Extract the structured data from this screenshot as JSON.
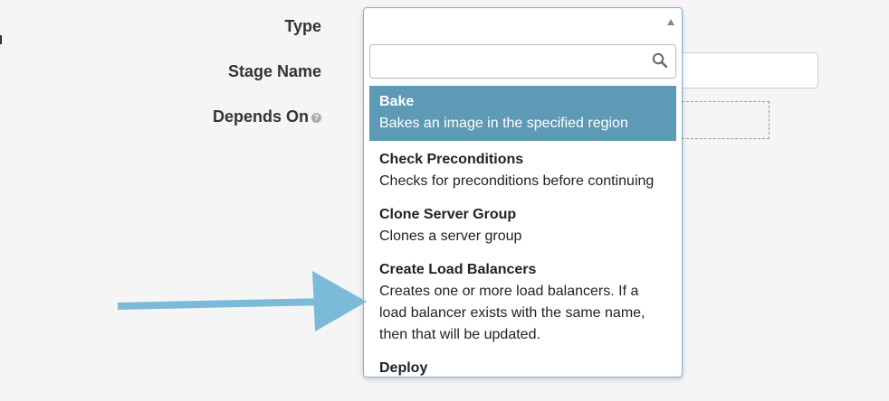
{
  "form": {
    "type_label": "Type",
    "stage_name_label": "Stage Name",
    "depends_on_label": "Depends On"
  },
  "dropdown": {
    "search_placeholder": "",
    "options": [
      {
        "name": "Bake",
        "description": "Bakes an image in the specified region",
        "selected": true
      },
      {
        "name": "Check Preconditions",
        "description": "Checks for preconditions before continuing"
      },
      {
        "name": "Clone Server Group",
        "description": "Clones a server group"
      },
      {
        "name": "Create Load Balancers",
        "description": "Creates one or more load balancers. If a load balancer exists with the same name, then that will be updated."
      },
      {
        "name": "Deploy",
        "description": ""
      }
    ]
  },
  "colors": {
    "selected_option_bg": "#5c9ab5",
    "annotation_arrow": "#7bbad9",
    "dropdown_border": "#7fb2d6"
  },
  "icons": {
    "caret": "caret-up-icon",
    "search": "search-icon",
    "help": "question-circle-icon"
  }
}
